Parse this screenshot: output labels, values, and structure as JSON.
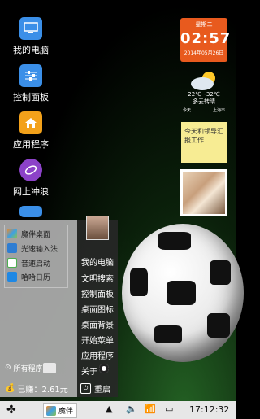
{
  "desktop": {
    "icons": [
      {
        "label": "我的电脑",
        "color": "#3b8fe8",
        "icon": "computer-icon"
      },
      {
        "label": "控制面板",
        "color": "#3b8fe8",
        "icon": "sliders-icon"
      },
      {
        "label": "应用程序",
        "color": "#f3a11a",
        "icon": "home-icon"
      },
      {
        "label": "网上冲浪",
        "color": "#8c42c8",
        "icon": "browser-icon"
      }
    ]
  },
  "widgets": {
    "clock": {
      "day": "星期二",
      "time": "02:57",
      "date": "2014年05月26日"
    },
    "weather": {
      "temp": "22℃~32℃",
      "condition": "多云转晴",
      "day": "今天",
      "city": "上海市"
    },
    "note": {
      "text": "今天和领导汇报工作"
    }
  },
  "start_menu": {
    "apps": [
      "魔伴桌面",
      "光速输入法",
      "音速启动",
      "哈哈日历"
    ],
    "all_programs": "所有程序",
    "earnings_label": "已赚：2.61元",
    "links": [
      "我的电脑",
      "文明搜索",
      "控制面板",
      "桌面图标",
      "桌面背景",
      "开始菜单",
      "应用程序",
      "关于"
    ],
    "restart": "重启"
  },
  "taskbar": {
    "task_label": "魔伴",
    "time": "17:12:32"
  },
  "colors": {
    "clock_bg": "#e85a1e",
    "note_bg": "#f7ec93",
    "taskbar_bg": "#e7e7e7"
  }
}
